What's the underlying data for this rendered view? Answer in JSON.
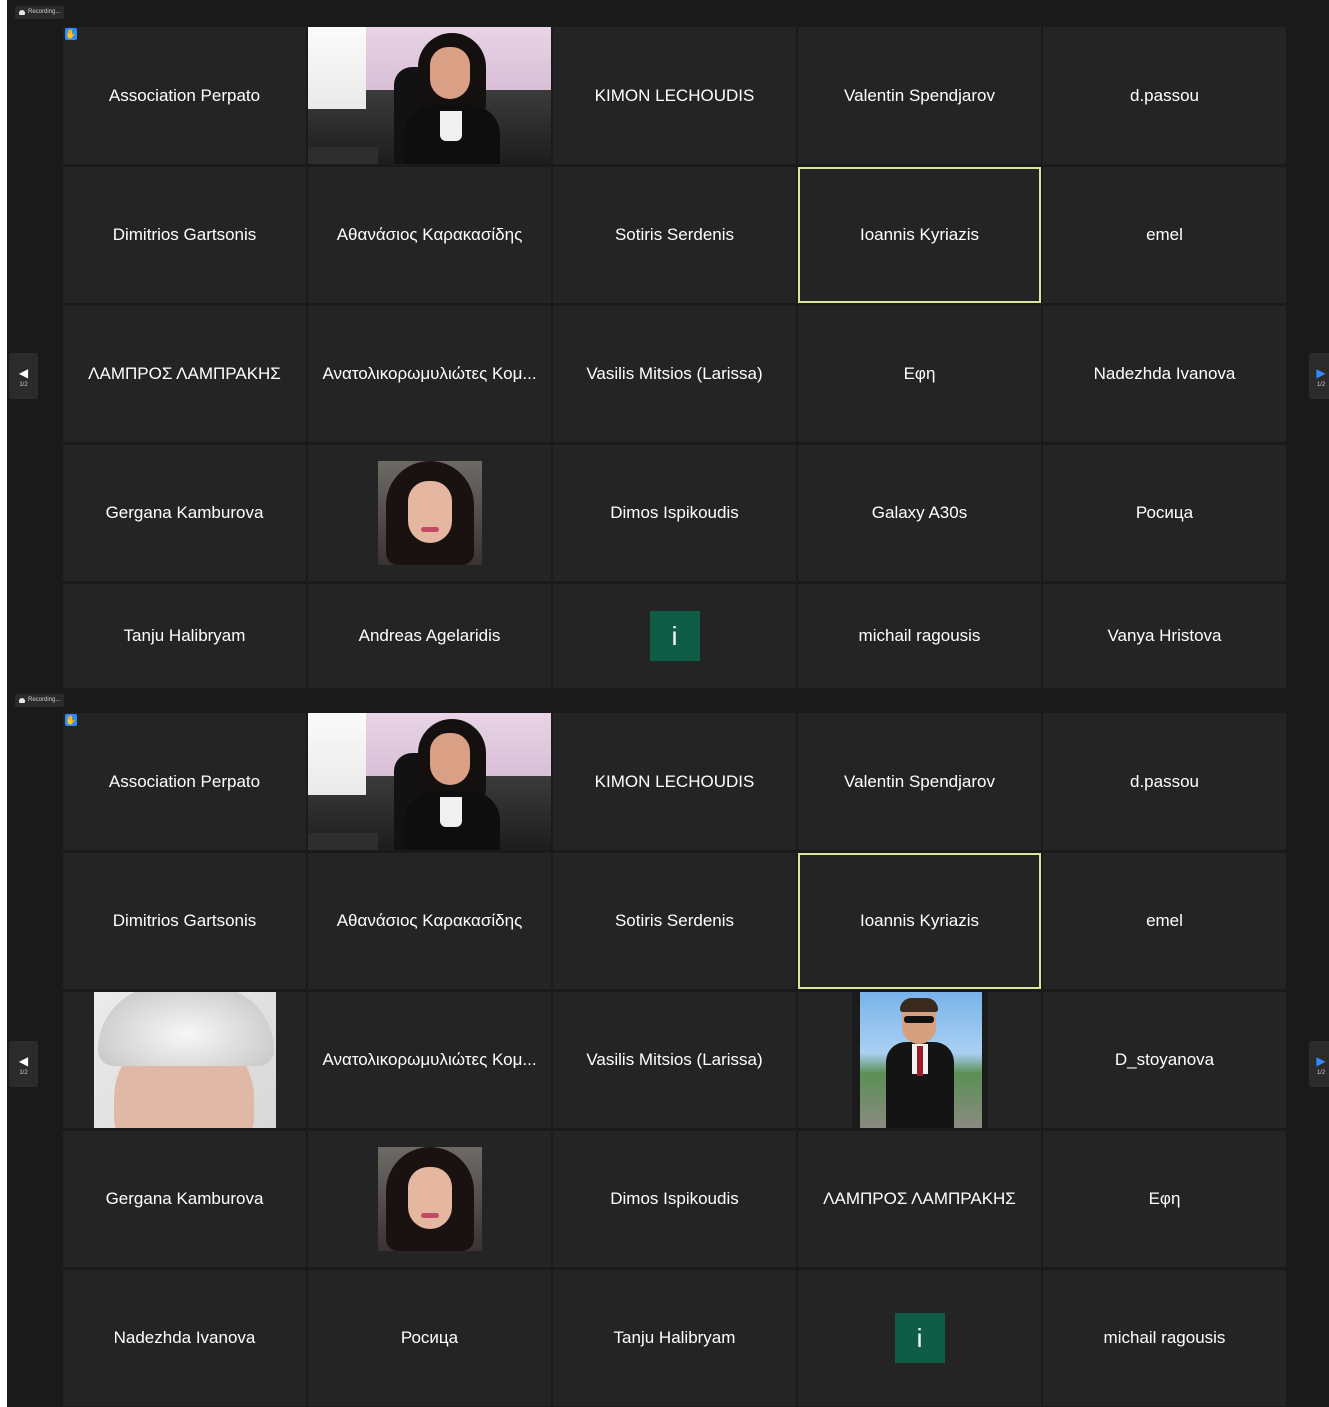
{
  "recording_label": "Recording...",
  "badge_icon": "raised-hand-icon",
  "page_indicator": "1/2",
  "info_tile_glyph": "i",
  "screens": [
    {
      "tiles": [
        [
          "Association Perpato",
          "",
          "KIMON LECHOUDIS",
          "Valentin Spendjarov",
          "d.passou"
        ],
        [
          "Dimitrios Gartsonis",
          "Αθανάσιος Καρακασίδης",
          "Sotiris Serdenis",
          "Ioannis Kyriazis",
          "emel"
        ],
        [
          "ΛΑΜΠΡΟΣ ΛΑΜΠΡΑΚΗΣ",
          "Ανατολικορωμυλιώτες Κομ...",
          "Vasilis Mitsios (Larissa)",
          "Εφη",
          "Nadezhda Ivanova"
        ],
        [
          "Gergana Kamburova",
          "",
          "Dimos Ispikoudis",
          "Galaxy A30s",
          "Росица"
        ],
        [
          "Tanju Halibryam",
          "Andreas Agelaridis",
          "",
          "michail ragousis",
          "Vanya Hristova"
        ]
      ]
    },
    {
      "tiles": [
        [
          "Association Perpato",
          "",
          "KIMON LECHOUDIS",
          "Valentin Spendjarov",
          "d.passou"
        ],
        [
          "Dimitrios Gartsonis",
          "Αθανάσιος Καρακασίδης",
          "Sotiris Serdenis",
          "Ioannis Kyriazis",
          "emel"
        ],
        [
          "",
          "Ανατολικορωμυλιώτες Κομ...",
          "Vasilis Mitsios (Larissa)",
          "",
          "D_stoyanova"
        ],
        [
          "Gergana Kamburova",
          "",
          "Dimos Ispikoudis",
          "ΛΑΜΠΡΟΣ ΛΑΜΠΡΑΚΗΣ",
          "Εφη"
        ],
        [
          "Nadezhda Ivanova",
          "Росица",
          "Tanju Halibryam",
          "",
          "michail ragousis"
        ]
      ]
    }
  ],
  "colors": {
    "background": "#1a1a1a",
    "tile": "#242424",
    "active_speaker_border": "#d8e79a",
    "info_tile": "#0f5d46",
    "accent": "#2d8cff"
  }
}
